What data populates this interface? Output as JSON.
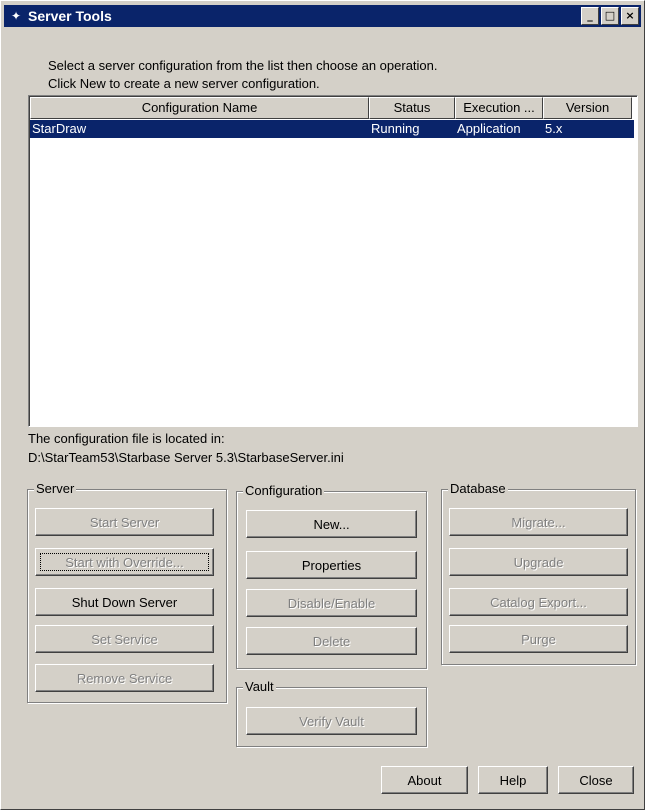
{
  "window": {
    "title": "Server Tools",
    "buttons": {
      "minimize": "_",
      "maximize": "□",
      "close": "×"
    }
  },
  "instructions": [
    "Select a server configuration from the list then choose an operation.",
    "Click New to create a new server configuration."
  ],
  "list": {
    "columns": [
      "Configuration Name",
      "Status",
      "Execution ...",
      "Version"
    ],
    "rows": [
      {
        "name": "StarDraw",
        "status": "Running",
        "execution": "Application",
        "version": "5.x"
      }
    ]
  },
  "config_file": {
    "label": "The configuration file is located in:",
    "path": "D:\\StarTeam53\\Starbase Server 5.3\\StarbaseServer.ini"
  },
  "server_group": {
    "label": "Server",
    "buttons": [
      "Start Server",
      "Start with Override...",
      "Shut Down Server",
      "Set Service",
      "Remove Service"
    ]
  },
  "configuration_group": {
    "label": "Configuration",
    "buttons": [
      "New...",
      "Properties",
      "Disable/Enable",
      "Delete"
    ]
  },
  "vault_group": {
    "label": "Vault",
    "buttons": [
      "Verify Vault"
    ]
  },
  "database_group": {
    "label": "Database",
    "buttons": [
      "Migrate...",
      "Upgrade",
      "Catalog Export...",
      "Purge"
    ]
  },
  "footer": {
    "about": "About",
    "help": "Help",
    "close": "Close"
  }
}
